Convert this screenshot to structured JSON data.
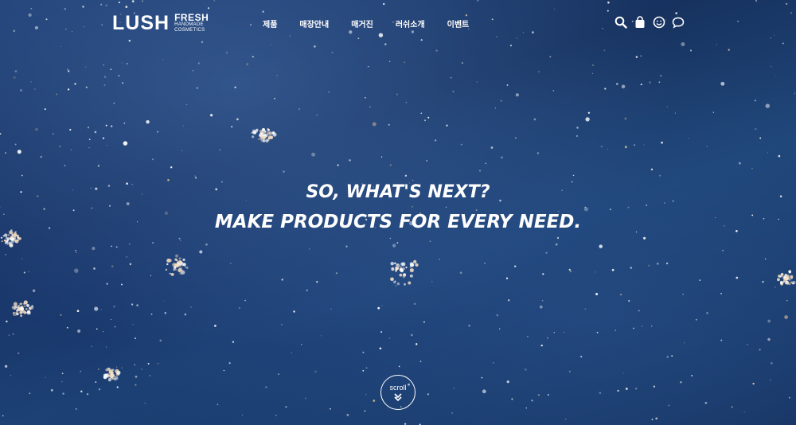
{
  "header": {
    "logo": {
      "word": "LUSH",
      "fresh": "FRESH",
      "line2": "HANDMADE",
      "line3": "COSMETICS"
    },
    "menu": [
      {
        "label": "제품"
      },
      {
        "label": "매장안내"
      },
      {
        "label": "매거진"
      },
      {
        "label": "러쉬소개"
      },
      {
        "label": "이벤트"
      }
    ],
    "icons": [
      "search-icon",
      "shopping-bag-icon",
      "user-smiley-icon",
      "chat-bubble-icon"
    ]
  },
  "hero": {
    "line1": "SO, WHAT'S NEXT?",
    "line2": "MAKE PRODUCTS FOR EVERY NEED.",
    "scroll_label": "scroll"
  }
}
